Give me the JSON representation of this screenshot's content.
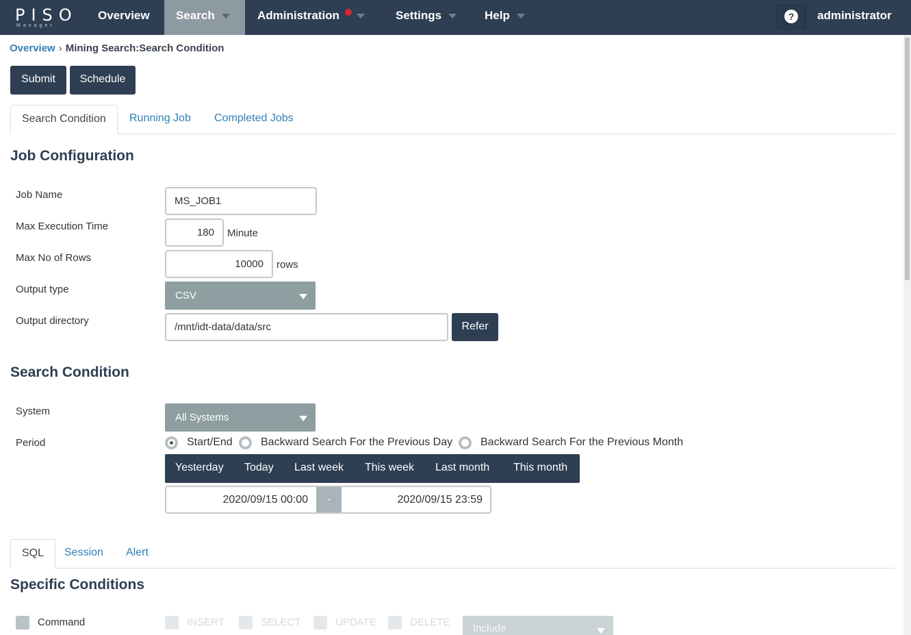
{
  "nav": {
    "logo_main": "PISO",
    "logo_sub": "Manager",
    "items": [
      {
        "label": "Overview"
      },
      {
        "label": "Search"
      },
      {
        "label": "Administration"
      },
      {
        "label": "Settings"
      },
      {
        "label": "Help"
      }
    ],
    "help_symbol": "?",
    "user": "administrator",
    "active_item": "Search",
    "notification_on": "Administration",
    "colors": {
      "navbar": "#2e3e53",
      "active": "#8e9aa1",
      "notification": "#d4282e"
    }
  },
  "breadcrumb": {
    "home": "Overview",
    "separator": "›",
    "current": "Mining Search:Search Condition"
  },
  "actions": {
    "submit": "Submit",
    "schedule": "Schedule"
  },
  "tabs": [
    "Search Condition",
    "Running Job",
    "Completed Jobs"
  ],
  "job_config": {
    "title": "Job Configuration",
    "job_name_label": "Job Name",
    "job_name_value": "MS_JOB1",
    "max_exec_label": "Max Execution Time",
    "max_exec_value": "180",
    "max_exec_unit": "Minute",
    "max_rows_label": "Max No of Rows",
    "max_rows_value": "10000",
    "max_rows_unit": "rows",
    "output_type_label": "Output type",
    "output_type_value": "CSV",
    "output_dir_label": "Output directory",
    "output_dir_value": "/mnt/idt-data/data/src",
    "refer_button": "Refer"
  },
  "search_condition": {
    "title": "Search Condition",
    "system_label": "System",
    "system_value": "All Systems",
    "period_label": "Period",
    "period_options": [
      "Start/End",
      "Backward Search For the Previous Day",
      "Backward Search For the Previous Month"
    ],
    "period_selected": "Start/End",
    "quick_ranges": [
      "Yesterday",
      "Today",
      "Last week",
      "This week",
      "Last month",
      "This month"
    ],
    "start": "2020/09/15 00:00",
    "range_separator": "-",
    "end": "2020/09/15 23:59"
  },
  "sub_tabs": [
    "SQL",
    "Session",
    "Alert"
  ],
  "specific": {
    "title": "Specific Conditions",
    "command_label": "Command",
    "command_options": [
      "INSERT",
      "SELECT",
      "UPDATE",
      "DELETE"
    ],
    "match_value": "Include"
  },
  "icons": {
    "dropdown": "chevron-down-icon",
    "help": "question-circle-icon",
    "notification": "notification-dot-icon"
  }
}
